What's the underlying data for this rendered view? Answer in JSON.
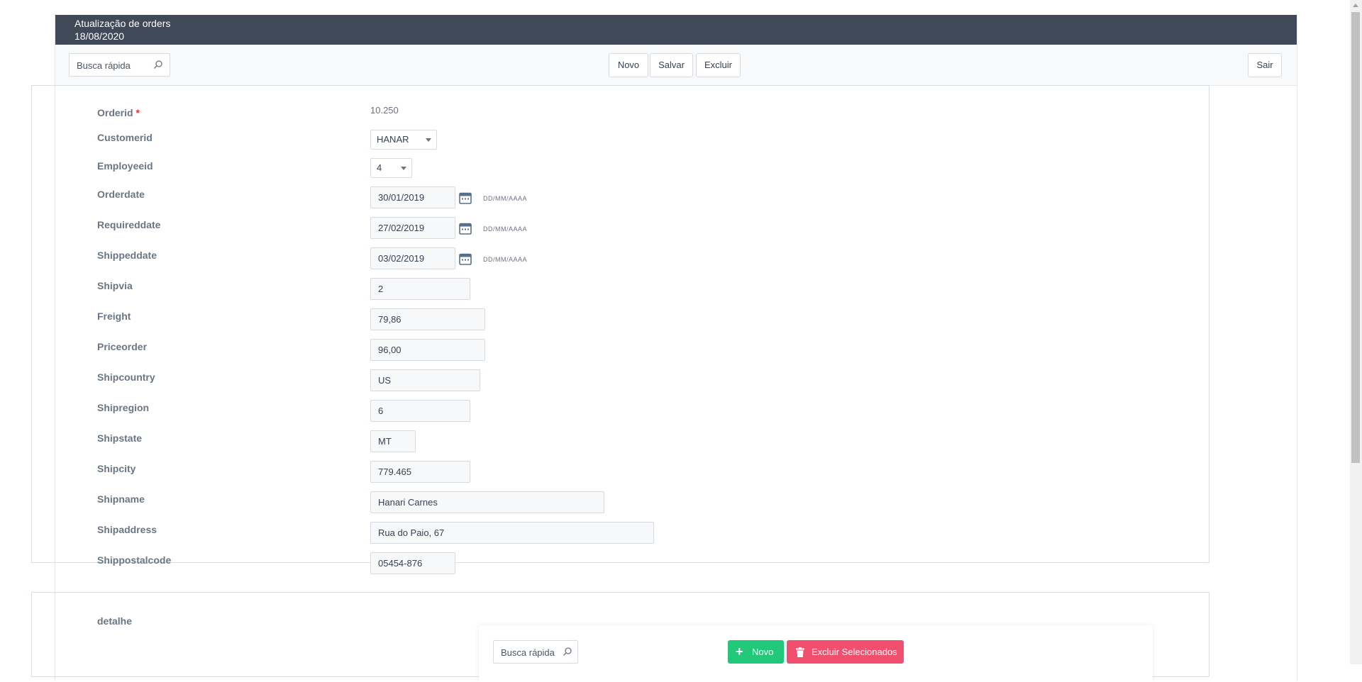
{
  "header": {
    "title": "Atualização de orders",
    "date": "18/08/2020"
  },
  "toolbar": {
    "search_placeholder": "Busca rápida",
    "new_label": "Novo",
    "save_label": "Salvar",
    "delete_label": "Excluir",
    "exit_label": "Sair"
  },
  "form": {
    "date_format": "DD/MM/AAAA",
    "required_mark": "*",
    "fields": {
      "orderid": {
        "label": "Orderid",
        "value": "10.250"
      },
      "customerid": {
        "label": "Customerid",
        "value": "HANAR"
      },
      "employeeid": {
        "label": "Employeeid",
        "value": "4"
      },
      "orderdate": {
        "label": "Orderdate",
        "value": "30/01/2019"
      },
      "requireddate": {
        "label": "Requireddate",
        "value": "27/02/2019"
      },
      "shippeddate": {
        "label": "Shippeddate",
        "value": "03/02/2019"
      },
      "shipvia": {
        "label": "Shipvia",
        "value": "2"
      },
      "freight": {
        "label": "Freight",
        "value": "79,86"
      },
      "priceorder": {
        "label": "Priceorder",
        "value": "96,00"
      },
      "shipcountry": {
        "label": "Shipcountry",
        "value": "US"
      },
      "shipregion": {
        "label": "Shipregion",
        "value": "6"
      },
      "shipstate": {
        "label": "Shipstate",
        "value": "MT"
      },
      "shipcity": {
        "label": "Shipcity",
        "value": "779.465"
      },
      "shipname": {
        "label": "Shipname",
        "value": "Hanari Carnes"
      },
      "shipaddress": {
        "label": "Shipaddress",
        "value": "Rua do Paio, 67"
      },
      "shippostalcode": {
        "label": "Shippostalcode",
        "value": "05454-876"
      }
    }
  },
  "detail": {
    "label": "detalhe",
    "search_placeholder": "Busca rápida",
    "new_label": "Novo",
    "delete_selected_label": "Excluir Selecionados"
  },
  "colors": {
    "header_bg": "#3f4957",
    "new_green": "#21c87a",
    "delete_pink": "#f0506e",
    "calendar_icon": "#5a6f87"
  }
}
